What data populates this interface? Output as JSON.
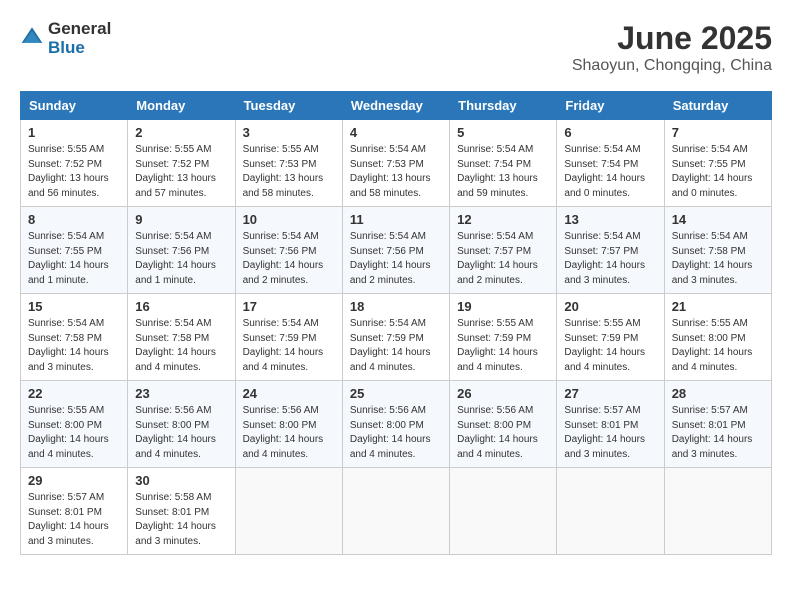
{
  "header": {
    "logo_general": "General",
    "logo_blue": "Blue",
    "month_year": "June 2025",
    "location": "Shaoyun, Chongqing, China"
  },
  "weekdays": [
    "Sunday",
    "Monday",
    "Tuesday",
    "Wednesday",
    "Thursday",
    "Friday",
    "Saturday"
  ],
  "weeks": [
    [
      {
        "day": "1",
        "sunrise": "5:55 AM",
        "sunset": "7:52 PM",
        "daylight": "13 hours and 56 minutes."
      },
      {
        "day": "2",
        "sunrise": "5:55 AM",
        "sunset": "7:52 PM",
        "daylight": "13 hours and 57 minutes."
      },
      {
        "day": "3",
        "sunrise": "5:55 AM",
        "sunset": "7:53 PM",
        "daylight": "13 hours and 58 minutes."
      },
      {
        "day": "4",
        "sunrise": "5:54 AM",
        "sunset": "7:53 PM",
        "daylight": "13 hours and 58 minutes."
      },
      {
        "day": "5",
        "sunrise": "5:54 AM",
        "sunset": "7:54 PM",
        "daylight": "13 hours and 59 minutes."
      },
      {
        "day": "6",
        "sunrise": "5:54 AM",
        "sunset": "7:54 PM",
        "daylight": "14 hours and 0 minutes."
      },
      {
        "day": "7",
        "sunrise": "5:54 AM",
        "sunset": "7:55 PM",
        "daylight": "14 hours and 0 minutes."
      }
    ],
    [
      {
        "day": "8",
        "sunrise": "5:54 AM",
        "sunset": "7:55 PM",
        "daylight": "14 hours and 1 minute."
      },
      {
        "day": "9",
        "sunrise": "5:54 AM",
        "sunset": "7:56 PM",
        "daylight": "14 hours and 1 minute."
      },
      {
        "day": "10",
        "sunrise": "5:54 AM",
        "sunset": "7:56 PM",
        "daylight": "14 hours and 2 minutes."
      },
      {
        "day": "11",
        "sunrise": "5:54 AM",
        "sunset": "7:56 PM",
        "daylight": "14 hours and 2 minutes."
      },
      {
        "day": "12",
        "sunrise": "5:54 AM",
        "sunset": "7:57 PM",
        "daylight": "14 hours and 2 minutes."
      },
      {
        "day": "13",
        "sunrise": "5:54 AM",
        "sunset": "7:57 PM",
        "daylight": "14 hours and 3 minutes."
      },
      {
        "day": "14",
        "sunrise": "5:54 AM",
        "sunset": "7:58 PM",
        "daylight": "14 hours and 3 minutes."
      }
    ],
    [
      {
        "day": "15",
        "sunrise": "5:54 AM",
        "sunset": "7:58 PM",
        "daylight": "14 hours and 3 minutes."
      },
      {
        "day": "16",
        "sunrise": "5:54 AM",
        "sunset": "7:58 PM",
        "daylight": "14 hours and 4 minutes."
      },
      {
        "day": "17",
        "sunrise": "5:54 AM",
        "sunset": "7:59 PM",
        "daylight": "14 hours and 4 minutes."
      },
      {
        "day": "18",
        "sunrise": "5:54 AM",
        "sunset": "7:59 PM",
        "daylight": "14 hours and 4 minutes."
      },
      {
        "day": "19",
        "sunrise": "5:55 AM",
        "sunset": "7:59 PM",
        "daylight": "14 hours and 4 minutes."
      },
      {
        "day": "20",
        "sunrise": "5:55 AM",
        "sunset": "7:59 PM",
        "daylight": "14 hours and 4 minutes."
      },
      {
        "day": "21",
        "sunrise": "5:55 AM",
        "sunset": "8:00 PM",
        "daylight": "14 hours and 4 minutes."
      }
    ],
    [
      {
        "day": "22",
        "sunrise": "5:55 AM",
        "sunset": "8:00 PM",
        "daylight": "14 hours and 4 minutes."
      },
      {
        "day": "23",
        "sunrise": "5:56 AM",
        "sunset": "8:00 PM",
        "daylight": "14 hours and 4 minutes."
      },
      {
        "day": "24",
        "sunrise": "5:56 AM",
        "sunset": "8:00 PM",
        "daylight": "14 hours and 4 minutes."
      },
      {
        "day": "25",
        "sunrise": "5:56 AM",
        "sunset": "8:00 PM",
        "daylight": "14 hours and 4 minutes."
      },
      {
        "day": "26",
        "sunrise": "5:56 AM",
        "sunset": "8:00 PM",
        "daylight": "14 hours and 4 minutes."
      },
      {
        "day": "27",
        "sunrise": "5:57 AM",
        "sunset": "8:01 PM",
        "daylight": "14 hours and 3 minutes."
      },
      {
        "day": "28",
        "sunrise": "5:57 AM",
        "sunset": "8:01 PM",
        "daylight": "14 hours and 3 minutes."
      }
    ],
    [
      {
        "day": "29",
        "sunrise": "5:57 AM",
        "sunset": "8:01 PM",
        "daylight": "14 hours and 3 minutes."
      },
      {
        "day": "30",
        "sunrise": "5:58 AM",
        "sunset": "8:01 PM",
        "daylight": "14 hours and 3 minutes."
      },
      null,
      null,
      null,
      null,
      null
    ]
  ]
}
